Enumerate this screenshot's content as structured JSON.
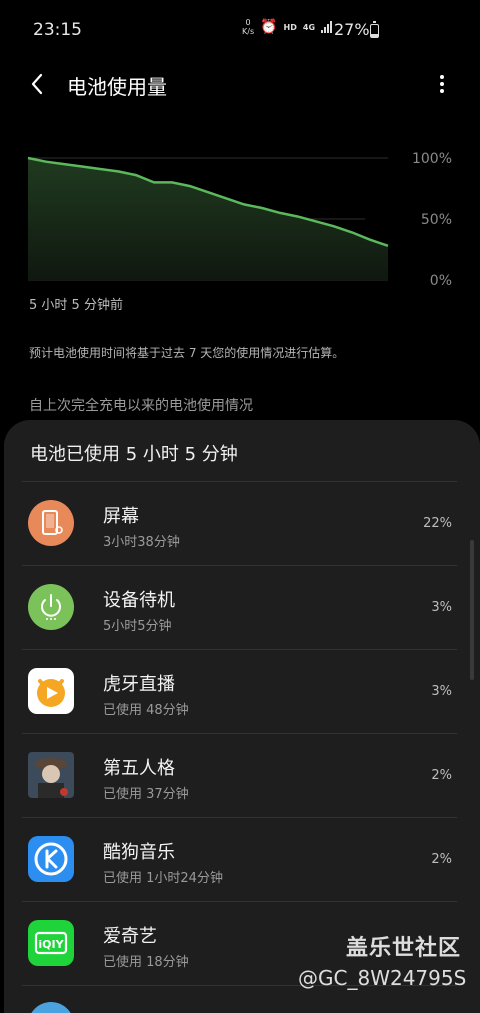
{
  "status_bar": {
    "time": "23:15",
    "net_speed_value": "0",
    "net_speed_unit": "K/s",
    "hd": "HD",
    "network": "4G",
    "battery_percent": "27%",
    "battery_level": 0.27
  },
  "header": {
    "title": "电池使用量",
    "back_icon": "chevron-left-icon",
    "more_icon": "more-vertical-icon"
  },
  "chart_data": {
    "type": "area",
    "title": "",
    "xlabel": "",
    "ylabel": "",
    "ylim": [
      0,
      100
    ],
    "y_ticks": [
      "100%",
      "50%",
      "0%"
    ],
    "grid": true,
    "color": "#5cb85c",
    "x": [
      0,
      1,
      2,
      3,
      4,
      5,
      6,
      7,
      8,
      9,
      10,
      11,
      12,
      13,
      14,
      15,
      16,
      17,
      18,
      19,
      20
    ],
    "values": [
      100,
      97,
      95,
      93,
      91,
      89,
      86,
      80,
      80,
      77,
      72,
      67,
      62,
      59,
      55,
      52,
      48,
      44,
      39,
      33,
      28
    ]
  },
  "chart_caption": "5 小时 5 分钟前",
  "estimate_note": "预计电池使用时间将基于过去 7 天您的使用情况进行估算。",
  "section_title": "自上次完全充电以来的电池使用情况",
  "panel": {
    "title": "电池已使用 5 小时 5 分钟",
    "apps": [
      {
        "name": "屏幕",
        "detail": "3小时38分钟",
        "percent": "22%",
        "icon": "screen-icon"
      },
      {
        "name": "设备待机",
        "detail": "5小时5分钟",
        "percent": "3%",
        "icon": "power-icon"
      },
      {
        "name": "虎牙直播",
        "detail": "已使用 48分钟",
        "percent": "3%",
        "icon": "huya-icon"
      },
      {
        "name": "第五人格",
        "detail": "已使用 37分钟",
        "percent": "2%",
        "icon": "identity-v-icon"
      },
      {
        "name": "酷狗音乐",
        "detail": "已使用 1小时24分钟",
        "percent": "2%",
        "icon": "kugou-icon"
      },
      {
        "name": "爱奇艺",
        "detail": "已使用 18分钟",
        "percent": "",
        "icon": "iqiyi-icon"
      }
    ]
  },
  "watermark": {
    "site": "盖乐世社区",
    "user": "@GC_8W24795S"
  }
}
